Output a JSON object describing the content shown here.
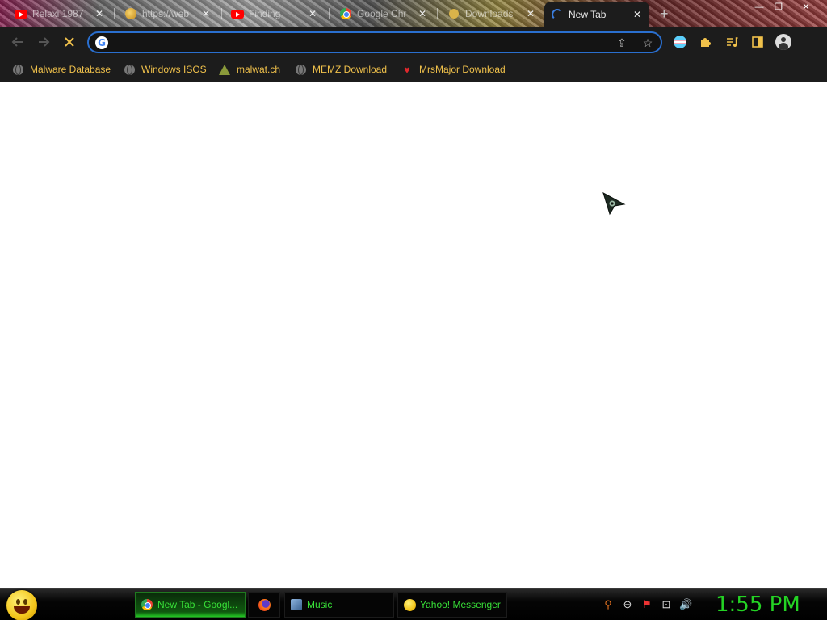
{
  "tabs": [
    {
      "title": "Relaxi 1987",
      "icon": "youtube-icon"
    },
    {
      "title": "https://web",
      "icon": "globe-icon"
    },
    {
      "title": "Finding",
      "icon": "youtube-icon"
    },
    {
      "title": "Google Chr",
      "icon": "chrome-icon"
    },
    {
      "title": "Downloads",
      "icon": "download-icon"
    },
    {
      "title": "New Tab",
      "icon": "loading-spinner-icon",
      "active": true
    }
  ],
  "window_controls": {
    "minimize": "—",
    "restore": "❐",
    "close": "✕"
  },
  "toolbar": {
    "back_icon": "back-arrow-icon",
    "forward_icon": "forward-arrow-icon",
    "stop_icon": "stop-loading-icon",
    "address_value": "",
    "address_placeholder": "",
    "share_icon": "share-icon",
    "bookmark_icon": "star-icon",
    "extensions": [
      "flag-extension-icon",
      "puzzle-extensions-icon",
      "media-playlist-icon",
      "side-panel-icon",
      "profile-avatar-icon"
    ]
  },
  "bookmarks": [
    {
      "label": "Malware Database",
      "icon": "globe-icon"
    },
    {
      "label": "Windows ISOS",
      "icon": "globe-icon"
    },
    {
      "label": "malwat.ch",
      "icon": "hazard-icon"
    },
    {
      "label": "MEMZ Download",
      "icon": "globe-icon"
    },
    {
      "label": "MrsMajor Download",
      "icon": "heart-icon"
    }
  ],
  "taskbar": {
    "start_icon": "smiley-start-icon",
    "tasks": [
      {
        "label": "New Tab - Googl...",
        "icon": "chrome-icon",
        "active": true
      },
      {
        "label": "",
        "icon": "firefox-icon",
        "active": false
      },
      {
        "label": "Music",
        "icon": "music-app-icon",
        "active": false
      },
      {
        "label": "Yahoo! Messenger",
        "icon": "yahoo-messenger-icon",
        "active": false
      }
    ],
    "tray": [
      "search-icon",
      "messenger-status-icon",
      "action-center-flag-icon",
      "network-icon",
      "volume-icon"
    ],
    "clock": "1:55 PM"
  },
  "colors": {
    "bookmark_text": "#f0c14b",
    "taskbar_text": "#38e038",
    "clock": "#24d324",
    "omnibox_border": "#2a6fcf"
  }
}
